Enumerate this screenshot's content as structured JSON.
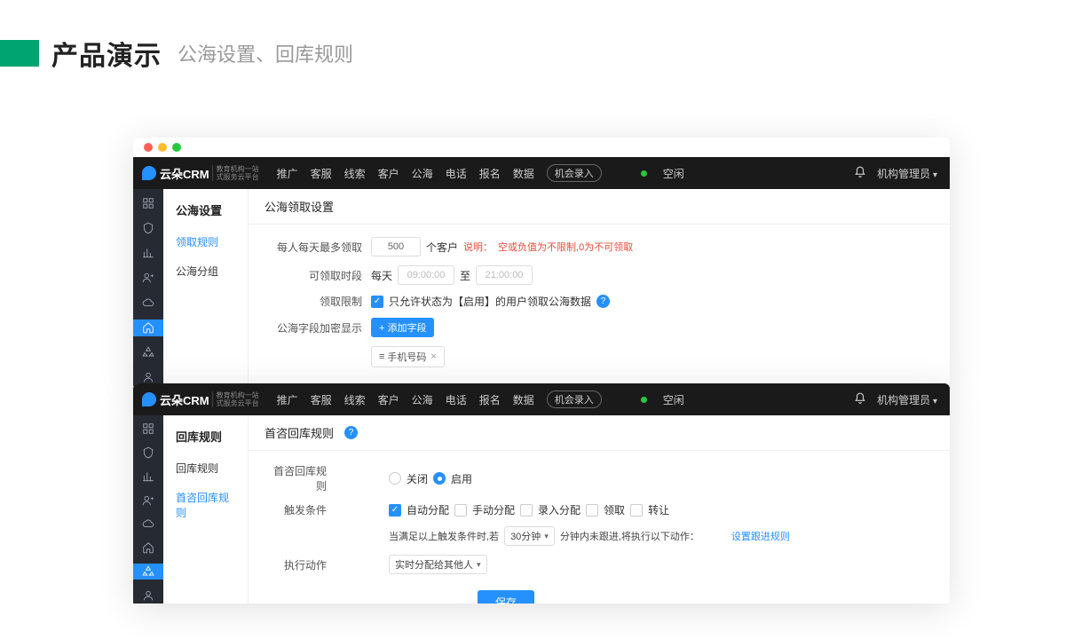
{
  "slide": {
    "title": "产品演示",
    "subtitle": "公海设置、回库规则"
  },
  "topnav": {
    "brand": "云朵CRM",
    "brand_sub1": "教育机构一站",
    "brand_sub2": "式服务云平台",
    "items": [
      "推广",
      "客服",
      "线索",
      "客户",
      "公海",
      "电话",
      "报名",
      "数据"
    ],
    "btn": "机会录入",
    "status": "空闲",
    "user": "机构管理员"
  },
  "w1": {
    "sidebar_title": "公海设置",
    "sidebar_items": [
      "领取规则",
      "公海分组"
    ],
    "sidebar_active": 0,
    "content_title": "公海领取设置",
    "f1_label": "每人每天最多领取",
    "f1_value": "500",
    "f1_unit": "个客户",
    "f1_hint_label": "说明：",
    "f1_hint": "空或负值为不限制,0为不可领取",
    "f2_label": "可领取时段",
    "f2_daily": "每天",
    "f2_from": "09:00:00",
    "f2_to_label": "至",
    "f2_to": "21:00:00",
    "f3_label": "领取限制",
    "f3_text": "只允许状态为【启用】的用户领取公海数据",
    "f4_label": "公海字段加密显示",
    "f4_btn": "添加字段",
    "f4_tag": "手机号码"
  },
  "w2": {
    "sidebar_title": "回库规则",
    "sidebar_items": [
      "回库规则",
      "首咨回库规则"
    ],
    "sidebar_active": 1,
    "content_title": "首咨回库规则",
    "f1_label": "首咨回库规则",
    "f1_off": "关闭",
    "f1_on": "启用",
    "f2_label": "触发条件",
    "f2_opts": [
      "自动分配",
      "手动分配",
      "录入分配",
      "领取",
      "转让"
    ],
    "f2_checked": [
      true,
      false,
      false,
      false,
      false
    ],
    "f3_pre": "当满足以上触发条件时,若",
    "f3_sel": "30分钟",
    "f3_post": "分钟内未跟进,将执行以下动作：",
    "f3_link": "设置跟进规则",
    "f4_label": "执行动作",
    "f4_sel": "实时分配给其他人",
    "save": "保存"
  }
}
